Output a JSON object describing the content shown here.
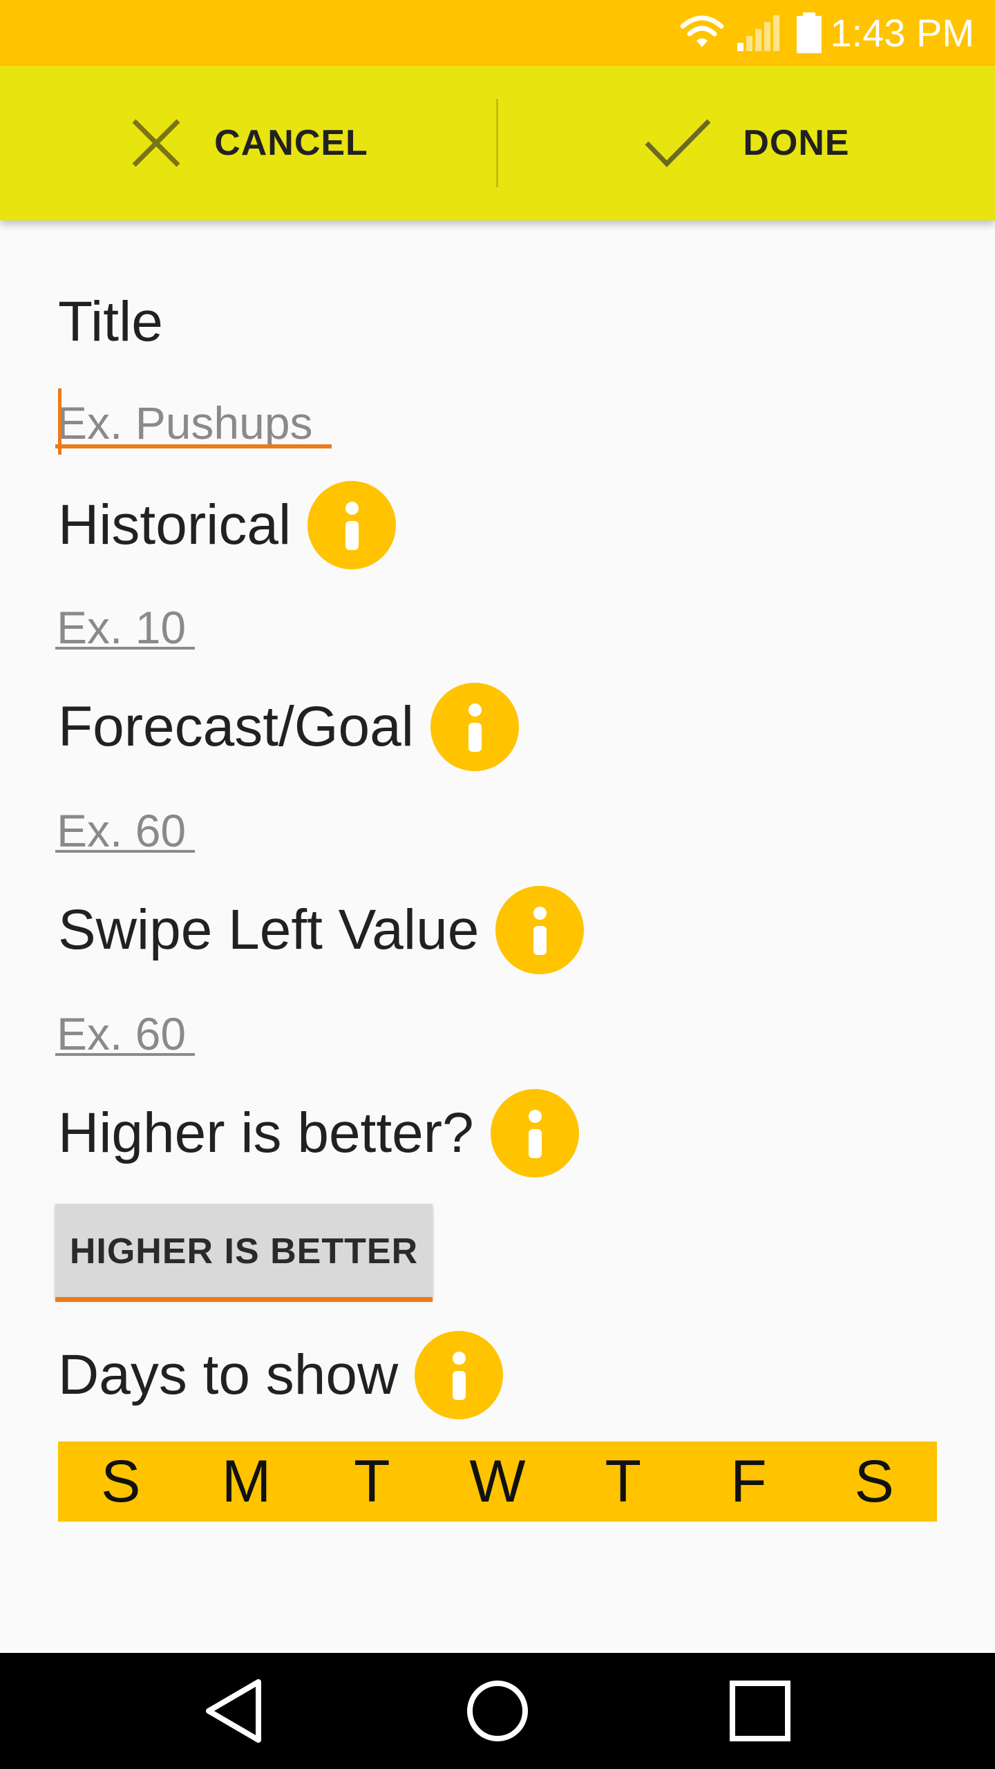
{
  "status_bar": {
    "time": "1:43 PM",
    "icons": [
      "wifi-icon",
      "cell-signal-icon",
      "battery-icon"
    ],
    "background": "#ffc300"
  },
  "action_bar": {
    "cancel_label": "CANCEL",
    "done_label": "DONE",
    "background": "#e8e410"
  },
  "form": {
    "title": {
      "label": "Title",
      "placeholder": "Ex. Pushups",
      "focused": true
    },
    "historical": {
      "label": "Historical",
      "placeholder": "Ex. 10"
    },
    "forecast": {
      "label": "Forecast/Goal",
      "placeholder": "Ex. 60"
    },
    "swipe_left": {
      "label": "Swipe Left Value",
      "placeholder": "Ex. 60"
    },
    "higher_is_better": {
      "label": "Higher is better?",
      "button_label": "HIGHER IS BETTER"
    },
    "days_to_show": {
      "label": "Days to show",
      "days": [
        "S",
        "M",
        "T",
        "W",
        "T",
        "F",
        "S"
      ]
    }
  },
  "colors": {
    "accent": "#ffc300",
    "focus": "#ec7b1a",
    "toolbar": "#e8e410"
  },
  "nav_bar": {
    "icons": [
      "back-icon",
      "home-icon",
      "recents-icon"
    ]
  }
}
